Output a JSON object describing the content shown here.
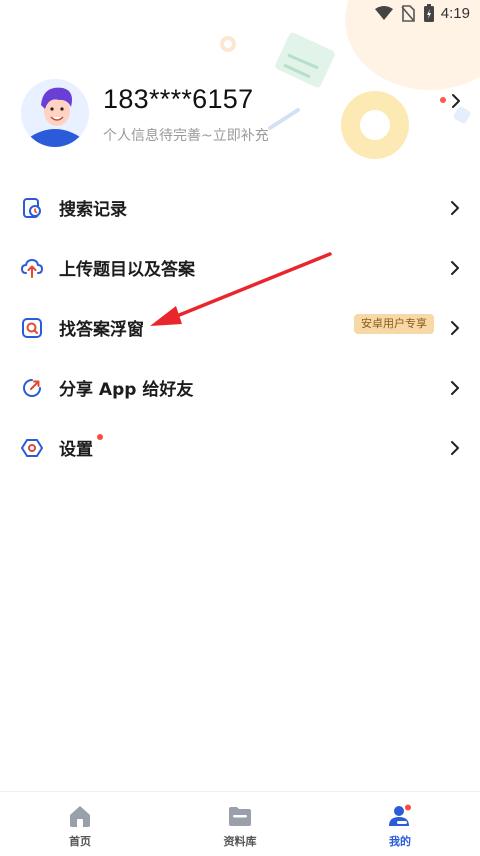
{
  "status_bar": {
    "time": "4:19",
    "icons": [
      "wifi-icon",
      "no-sim-icon",
      "battery-charging-icon"
    ]
  },
  "profile": {
    "phone": "183****6157",
    "hint": "个人信息待完善~立即补充"
  },
  "menu": [
    {
      "label": "搜索记录",
      "icon": "history-icon"
    },
    {
      "label": "上传题目以及答案",
      "icon": "upload-icon"
    },
    {
      "label": "找答案浮窗",
      "icon": "floating-search-icon",
      "badge": "安卓用户专享"
    },
    {
      "label": "分享 App 给好友",
      "icon": "share-icon"
    },
    {
      "label": "设置",
      "icon": "settings-icon"
    }
  ],
  "bottom_nav": [
    {
      "label": "首页",
      "icon": "home-icon"
    },
    {
      "label": "资料库",
      "icon": "folder-icon"
    },
    {
      "label": "我的",
      "icon": "profile-icon",
      "active": true
    }
  ],
  "colors": {
    "accent": "#2b5bd9",
    "badge_bg": "#f7d9a7",
    "badge_text": "#8a5a1a",
    "notification_dot": "#ff4b3e",
    "arrow": "#e8262b"
  }
}
